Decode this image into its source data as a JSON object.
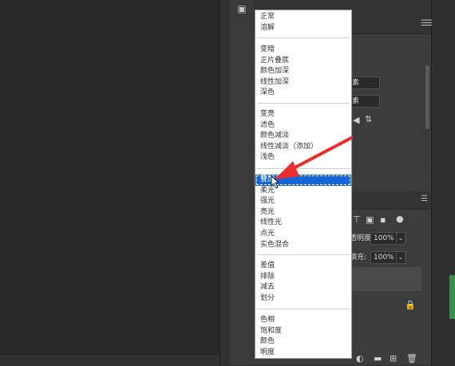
{
  "options_icon": "document-icon",
  "properties": {
    "field_1": "像素",
    "field_2": "像素"
  },
  "layers": {
    "opacity_label": "透明度:",
    "opacity_value": "100%",
    "fill_label": "填充:",
    "fill_value": "100%"
  },
  "blend_menu": {
    "groups": [
      [
        "正常",
        "溶解"
      ],
      [
        "变暗",
        "正片叠底",
        "颜色加深",
        "线性加深",
        "深色"
      ],
      [
        "变亮",
        "滤色",
        "颜色减淡",
        "线性减淡（添加）",
        "浅色"
      ],
      [
        "叠加",
        "柔光",
        "强光",
        "亮光",
        "线性光",
        "点光",
        "实色混合"
      ],
      [
        "差值",
        "排除",
        "减去",
        "划分"
      ],
      [
        "色相",
        "饱和度",
        "颜色",
        "明度"
      ]
    ],
    "selected": "叠加"
  },
  "colors": {
    "selection": "#1565d8",
    "annotation_arrow": "#e82e2e"
  }
}
